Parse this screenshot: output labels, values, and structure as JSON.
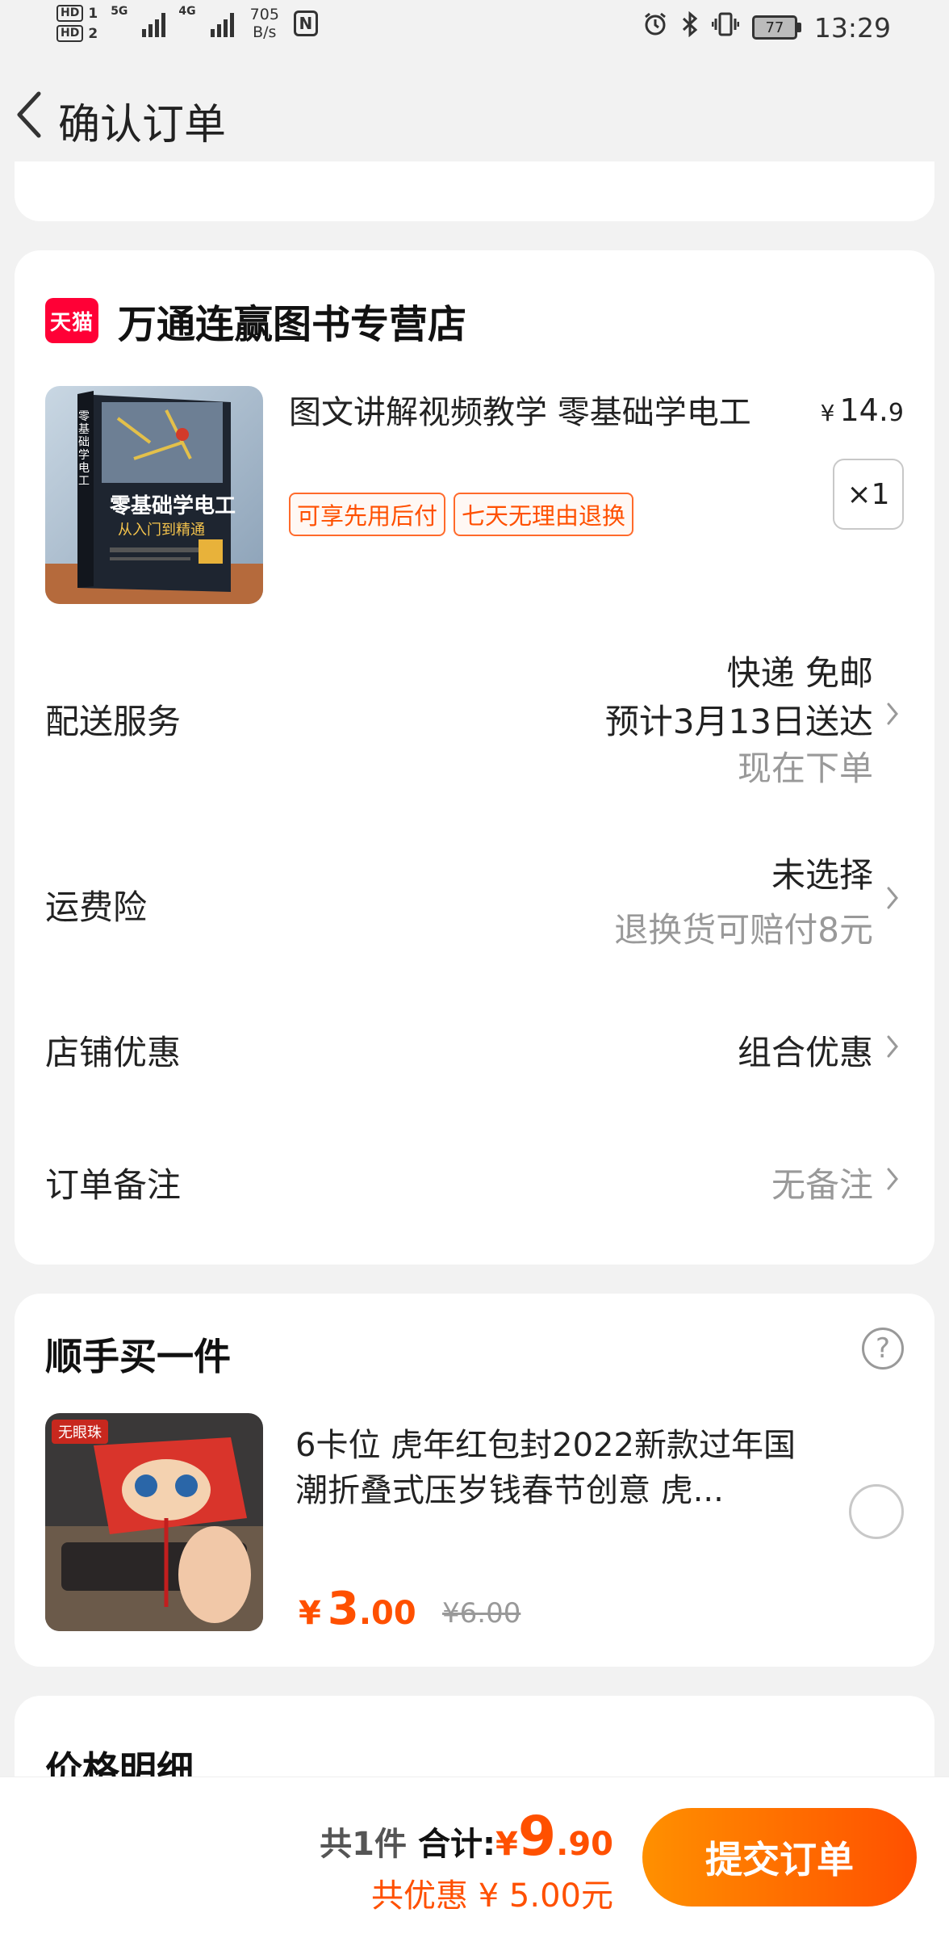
{
  "status_bar": {
    "hd1": "HD",
    "sim1": "1",
    "hd2": "HD",
    "sim2": "2",
    "net1": "5G",
    "net2": "4G",
    "speed_value": "705",
    "speed_unit": "B/s",
    "nfc": "N",
    "battery": "77",
    "time": "13:29"
  },
  "header": {
    "title": "确认订单"
  },
  "order": {
    "store": {
      "badge": "天猫",
      "name": "万通连赢图书专营店"
    },
    "product": {
      "title": "图文讲解视频教学 零基础学电工",
      "price_currency": "¥",
      "price_int": "14.",
      "price_dec": "9",
      "tags": [
        "可享先用后付",
        "七天无理由退换"
      ],
      "quantity": "×1",
      "image": {
        "cover_title": "零基础学电工",
        "cover_subtitle": "从入门到精通",
        "spine_text": "零基础学电工"
      }
    },
    "delivery": {
      "label": "配送服务",
      "line1": "快递 免邮",
      "line2": "预计3月13日送达",
      "line3": "现在下单"
    },
    "insurance": {
      "label": "运费险",
      "line1": "未选择",
      "line2": "退换货可赔付8元"
    },
    "store_discount": {
      "label": "店铺优惠",
      "value": "组合优惠"
    },
    "remark": {
      "label": "订单备注",
      "value": "无备注"
    }
  },
  "extra": {
    "title": "顺手买一件",
    "desc": "6卡位 虎年红包封2022新款过年国潮折叠式压岁钱春节创意 虎...",
    "image_badge": "无眼珠",
    "price_currency": "¥",
    "price_int": "3",
    "price_dec": ".00",
    "original_price": "¥6.00"
  },
  "price_detail": {
    "title": "价格明细"
  },
  "bottom": {
    "count": "共1件",
    "total_label": "合计:",
    "total_currency": "¥",
    "total_int": "9",
    "total_dec": ".90",
    "saving": "共优惠 ¥ 5.00元",
    "submit": "提交订单"
  },
  "colors": {
    "accent": "#ff5000",
    "tmall": "#ff0036",
    "button_gradient_start": "#ff9000",
    "button_gradient_end": "#ff5000"
  }
}
